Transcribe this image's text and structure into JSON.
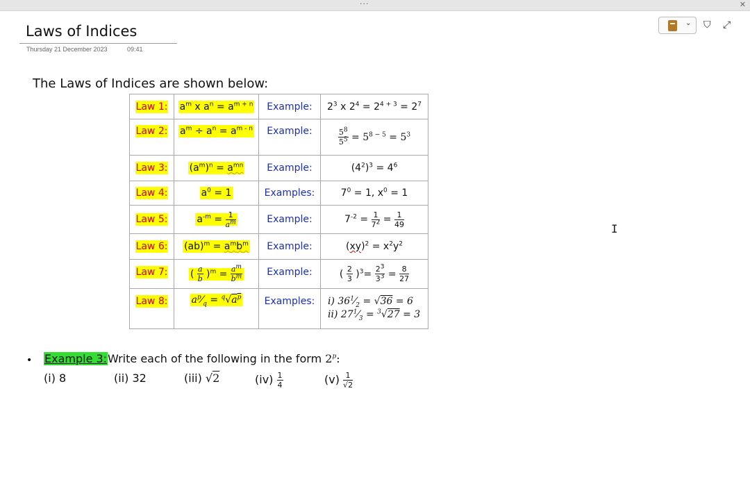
{
  "window": {
    "menu_dots": "···",
    "close_glyph": "✕"
  },
  "page": {
    "title": "Laws of Indices",
    "date": "Thursday 21 December 2023",
    "time": "09:41"
  },
  "toolbar": {
    "notebook_chevron": "⌄",
    "format_icon_glyph": "⛉",
    "expand_icon_glyph": "⤢"
  },
  "content": {
    "intro": "The Laws of Indices are shown below:",
    "laws": [
      {
        "label": "Law 1:",
        "example_label": "Example:"
      },
      {
        "label": "Law 2:",
        "example_label": "Example:"
      },
      {
        "label": "Law 3:",
        "example_label": "Example:"
      },
      {
        "label": "Law 4:",
        "example_label": "Examples:"
      },
      {
        "label": "Law 5:",
        "example_label": "Example:"
      },
      {
        "label": "Law 6:",
        "example_label": "Example:"
      },
      {
        "label": "Law 7:",
        "example_label": "Example:"
      },
      {
        "label": "Law 8:",
        "example_label": "Examples:"
      }
    ],
    "example3": {
      "label": "Example 3:",
      "instruction": "Write each of the following in the form",
      "parts": [
        "(i) 8",
        "(ii) 32",
        "(iii)",
        "(iv)",
        "(v)"
      ]
    }
  },
  "colors": {
    "law_label": "#d40000",
    "example_label": "#1c2fb4",
    "highlight_yellow": "#ffff00",
    "highlight_green": "#33dd33"
  },
  "icons": [
    "notebook-icon",
    "chevron-down-icon",
    "format-painter-icon",
    "expand-icon",
    "text-cursor-icon"
  ]
}
